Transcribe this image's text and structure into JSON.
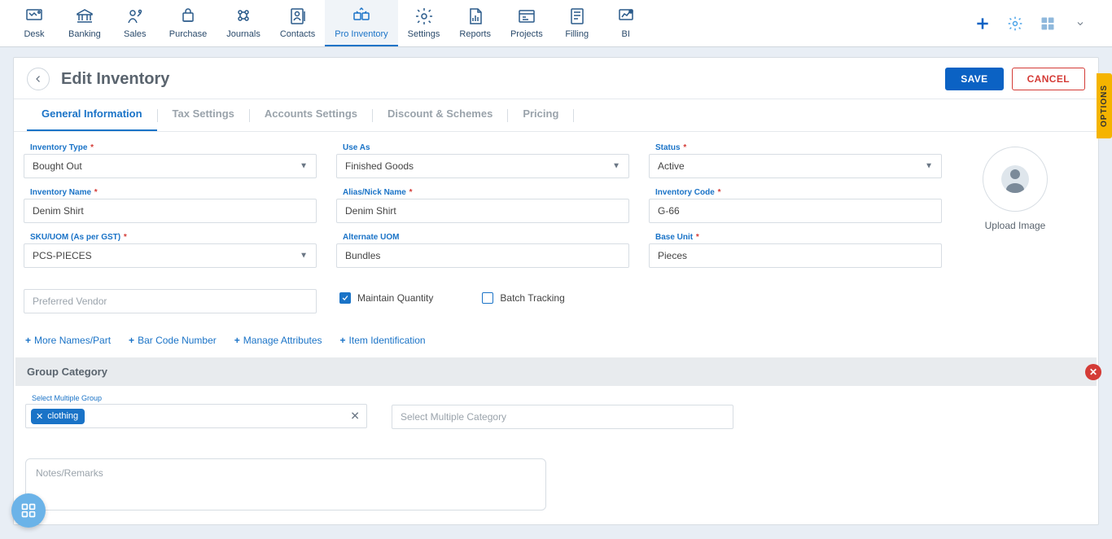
{
  "nav": {
    "items": [
      {
        "label": "Desk"
      },
      {
        "label": "Banking"
      },
      {
        "label": "Sales"
      },
      {
        "label": "Purchase"
      },
      {
        "label": "Journals"
      },
      {
        "label": "Contacts"
      },
      {
        "label": "Pro Inventory"
      },
      {
        "label": "Settings"
      },
      {
        "label": "Reports"
      },
      {
        "label": "Projects"
      },
      {
        "label": "Filling"
      },
      {
        "label": "BI"
      }
    ],
    "active_index": 6
  },
  "header": {
    "title": "Edit Inventory",
    "save": "SAVE",
    "cancel": "CANCEL"
  },
  "tabs": {
    "items": [
      "General Information",
      "Tax Settings",
      "Accounts Settings",
      "Discount & Schemes",
      "Pricing"
    ],
    "active_index": 0
  },
  "form": {
    "inventory_type": {
      "label": "Inventory Type",
      "required": true,
      "value": "Bought Out"
    },
    "use_as": {
      "label": "Use As",
      "required": false,
      "value": "Finished Goods"
    },
    "status": {
      "label": "Status",
      "required": true,
      "value": "Active"
    },
    "inventory_name": {
      "label": "Inventory Name",
      "required": true,
      "value": "Denim Shirt"
    },
    "alias": {
      "label": "Alias/Nick Name",
      "required": true,
      "value": "Denim Shirt"
    },
    "inventory_code": {
      "label": "Inventory Code",
      "required": true,
      "value": "G-66"
    },
    "sku": {
      "label": "SKU/UOM (As per GST)",
      "required": true,
      "value": "PCS-PIECES"
    },
    "alt_uom": {
      "label": "Alternate UOM",
      "required": false,
      "value": "Bundles"
    },
    "base_unit": {
      "label": "Base Unit",
      "required": true,
      "value": "Pieces"
    },
    "preferred_vendor": {
      "placeholder": "Preferred Vendor",
      "value": ""
    },
    "maintain_qty": {
      "label": "Maintain Quantity",
      "checked": true
    },
    "batch_tracking": {
      "label": "Batch Tracking",
      "checked": false
    }
  },
  "upload_label": "Upload Image",
  "links": [
    "More Names/Part",
    "Bar Code Number",
    "Manage Attributes",
    "Item Identification"
  ],
  "group": {
    "title": "Group Category",
    "multi_group_label": "Select Multiple Group",
    "multi_group_chips": [
      "clothing"
    ],
    "multi_category_placeholder": "Select Multiple Category"
  },
  "notes_placeholder": "Notes/Remarks",
  "options_tab": "OPTIONS"
}
